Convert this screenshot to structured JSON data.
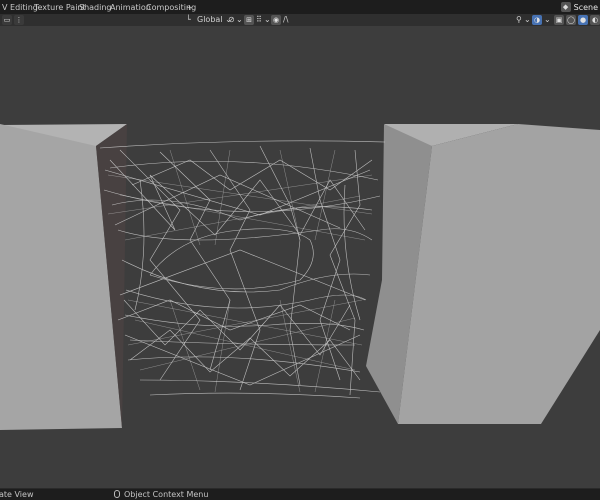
{
  "workspace_tabs": [
    "V Editing",
    "Texture Paint",
    "Shading",
    "Animation",
    "Compositing"
  ],
  "add_tab_label": "+",
  "scene": {
    "label": "Scene",
    "icon": "scene-icon"
  },
  "toolbar": {
    "orientation_label": "Global",
    "dropdown_glyph": "⌄",
    "curve_glyph": "/\\"
  },
  "statusbar": {
    "left_label": "ate View",
    "context_menu_label": "Object Context Menu"
  },
  "colors": {
    "viewport_bg": "#3d3d3d",
    "block_front": "#a7a7a7",
    "block_side": "#8e8e8e",
    "block_top": "#b3b3b3",
    "web_strand": "#d4d4d4",
    "header_bg": "#1d1d1d",
    "active_button": "#4772b3"
  },
  "icons": [
    "transform-orientation-icon",
    "pivot-icon",
    "snap-icon",
    "proportional-edit-icon",
    "view-gizmo-icon",
    "overlay-icon",
    "shading-icon"
  ]
}
